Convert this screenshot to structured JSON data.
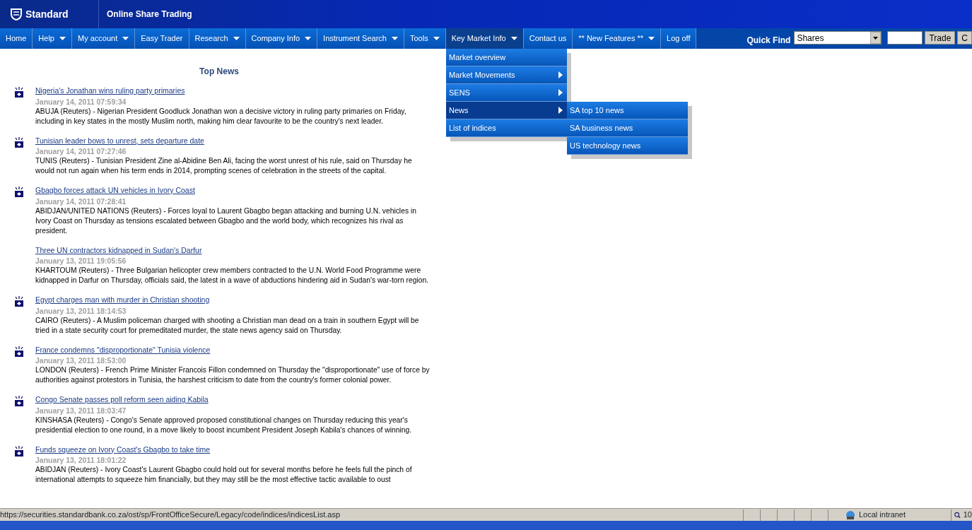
{
  "header": {
    "brand": "Standard",
    "title": "Online Share Trading"
  },
  "nav": [
    {
      "label": "Home",
      "has_caret": false,
      "selected": false
    },
    {
      "label": "Help",
      "has_caret": true,
      "selected": false
    },
    {
      "label": "My account",
      "has_caret": true,
      "selected": false
    },
    {
      "label": "Easy Trader",
      "has_caret": false,
      "selected": false
    },
    {
      "label": "Research",
      "has_caret": true,
      "selected": false
    },
    {
      "label": "Company Info",
      "has_caret": true,
      "selected": false
    },
    {
      "label": "Instrument Search",
      "has_caret": true,
      "selected": false
    },
    {
      "label": "Tools",
      "has_caret": true,
      "selected": false
    },
    {
      "label": "Key Market Info",
      "has_caret": true,
      "selected": true
    },
    {
      "label": "Contact us",
      "has_caret": false,
      "selected": false
    },
    {
      "label": "** New Features **",
      "has_caret": true,
      "selected": false
    },
    {
      "label": "Log off",
      "has_caret": false,
      "selected": false
    }
  ],
  "quick_find": {
    "label": "Quick Find",
    "select_value": "Shares",
    "buttons": [
      "Trade",
      "C"
    ]
  },
  "dropdown": [
    {
      "label": "Market overview",
      "has_submenu": false,
      "selected": false
    },
    {
      "label": "Market Movements",
      "has_submenu": true,
      "selected": false
    },
    {
      "label": "SENS",
      "has_submenu": true,
      "selected": false
    },
    {
      "label": "News",
      "has_submenu": true,
      "selected": true
    },
    {
      "label": "List of indices",
      "has_submenu": false,
      "selected": false
    }
  ],
  "submenu": [
    {
      "label": "SA top 10 news",
      "selected": false
    },
    {
      "label": "SA business news",
      "selected": false
    },
    {
      "label": "US technology news",
      "selected": false
    }
  ],
  "news": {
    "heading": "Top News",
    "items": [
      {
        "title": "Nigeria's Jonathan wins ruling party primaries",
        "date": "January 14, 2011 07:59:34",
        "body": "ABUJA (Reuters) - Nigerian President Goodluck Jonathan won a decisive victory in ruling party primaries on Friday, including in key states in the mostly Muslim north, making him clear favourite to be the country's next leader.",
        "has_icon": true
      },
      {
        "title": "Tunisian leader bows to unrest, sets departure date",
        "date": "January 14, 2011 07:27:46",
        "body": "TUNIS (Reuters) - Tunisian President Zine al-Abidine Ben Ali, facing the worst unrest of his rule, said on Thursday he would not run again when his term ends in 2014, prompting scenes of celebration in the streets of the capital.",
        "has_icon": true
      },
      {
        "title": "Gbagbo forces attack UN vehicles in Ivory Coast",
        "date": "January 14, 2011 07:28:41",
        "body": "ABIDJAN/UNITED NATIONS (Reuters) - Forces loyal to Laurent Gbagbo began attacking and burning U.N. vehicles in Ivory Coast on Thursday as tensions escalated between Gbagbo and the world body, which recognizes his rival as president.",
        "has_icon": true
      },
      {
        "title": "Three UN contractors kidnapped in Sudan's Darfur",
        "date": "January 13, 2011 19:05:56",
        "body": "KHARTOUM (Reuters) - Three Bulgarian helicopter crew members contracted to the U.N. World Food Programme were kidnapped in Darfur on Thursday, officials said, the latest in a wave of abductions hindering aid in Sudan's war-torn region.",
        "has_icon": false
      },
      {
        "title": "Egypt charges man with murder in Christian shooting",
        "date": "January 13, 2011 18:14:53",
        "body": "CAIRO (Reuters) - A Muslim policeman charged with shooting a Christian man dead on a train in southern Egypt will be tried in a state security court for premeditated murder, the state news agency said on Thursday.",
        "has_icon": true
      },
      {
        "title": "France condemns \"disproportionate\" Tunisia violence",
        "date": "January 13, 2011 18:53:00",
        "body": "LONDON (Reuters) - French Prime Minister Francois Fillon condemned on Thursday the \"disproportionate\" use of force by authorities against protestors in Tunisia, the harshest criticism to date from the country's former colonial power.",
        "has_icon": true
      },
      {
        "title": "Congo Senate passes poll reform seen aiding Kabila",
        "date": "January 13, 2011 18:03:47",
        "body": "KINSHASA (Reuters) - Congo's Senate approved proposed constitutional changes on Thursday reducing this year's presidential election to one round, in a move likely to boost incumbent President Joseph Kabila's chances of winning.",
        "has_icon": true
      },
      {
        "title": "Funds squeeze on Ivory Coast's Gbagbo to take time",
        "date": "January 13, 2011 18:01:22",
        "body": "ABIDJAN (Reuters) - Ivory Coast's Laurent Gbagbo could hold out for several months before he feels full the pinch of international attempts to squeeze him financially, but they may still be the most effective tactic available to oust",
        "has_icon": true
      }
    ]
  },
  "status_bar": {
    "url": "https://securities.standardbank.co.za/ost/sp/FrontOfficeSecure/Legacy/code/indices/indicesList.asp",
    "zone": "Local intranet",
    "zoom": "10"
  }
}
